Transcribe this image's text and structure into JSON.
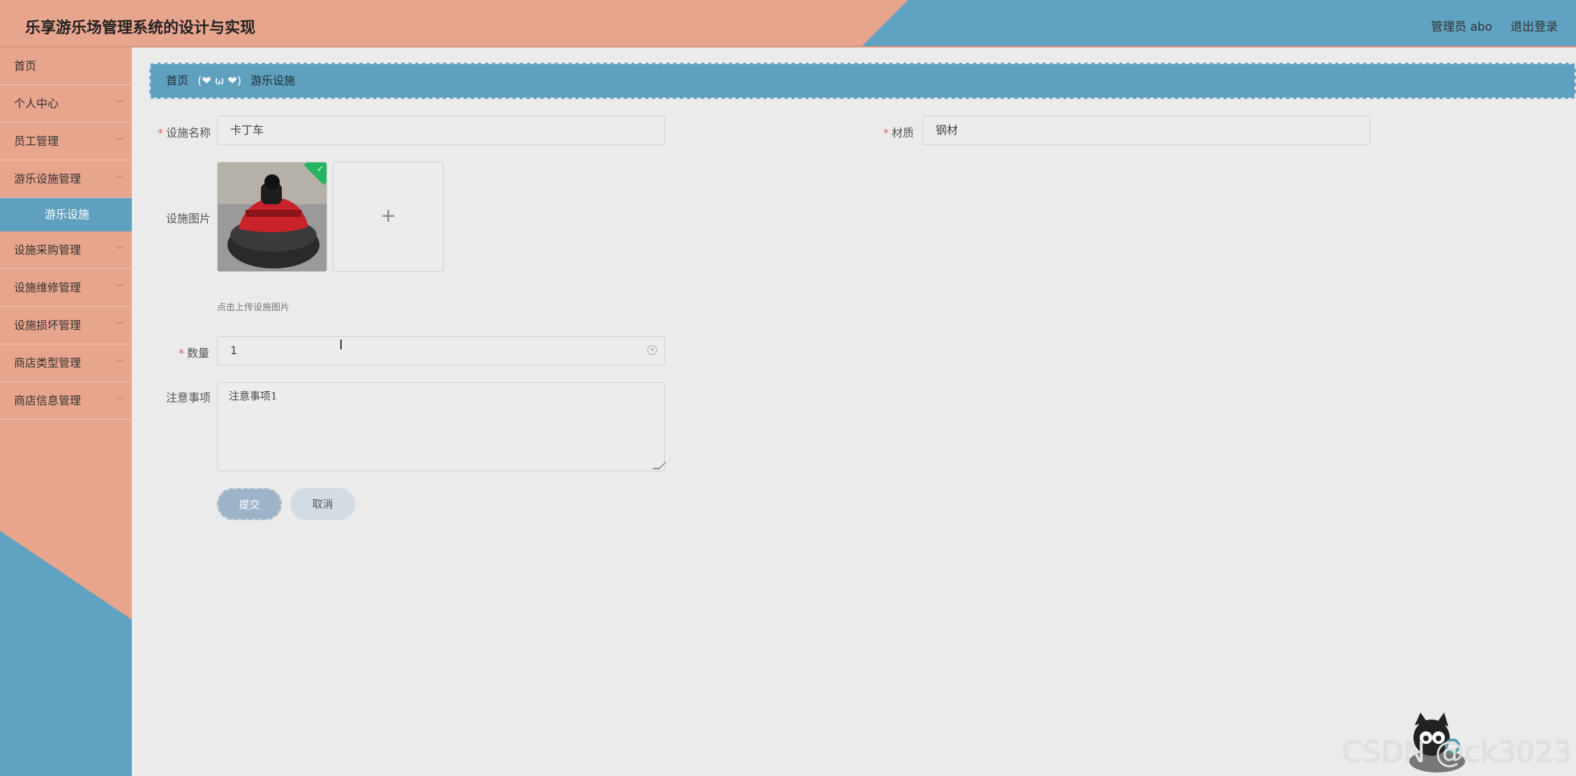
{
  "header": {
    "title": "乐享游乐场管理系统的设计与实现",
    "user": "管理员 abo",
    "logout": "退出登录"
  },
  "sidebar": {
    "items": [
      {
        "label": "首页"
      },
      {
        "label": "个人中心"
      },
      {
        "label": "员工管理"
      },
      {
        "label": "游乐设施管理"
      },
      {
        "label": "游乐设施"
      },
      {
        "label": "设施采购管理"
      },
      {
        "label": "设施维修管理"
      },
      {
        "label": "设施损坏管理"
      },
      {
        "label": "商店类型管理"
      },
      {
        "label": "商店信息管理"
      }
    ]
  },
  "breadcrumb": {
    "home": "首页",
    "separator": "(❤ ω ❤)",
    "current": "游乐设施"
  },
  "form": {
    "name_label": "设施名称",
    "name_value": "卡丁车",
    "material_label": "材质",
    "material_value": "钢材",
    "image_label": "设施图片",
    "upload_hint": "点击上传设施图片",
    "quantity_label": "数量",
    "quantity_value": "1",
    "notes_label": "注意事项",
    "notes_value": "注意事项1",
    "submit_label": "提交",
    "cancel_label": "取消"
  },
  "watermark": "CSDN @ck3023",
  "icons": {
    "plus": "plus-icon",
    "check": "check-icon",
    "chevron": "chevron-down-icon",
    "clear": "clear-icon"
  }
}
